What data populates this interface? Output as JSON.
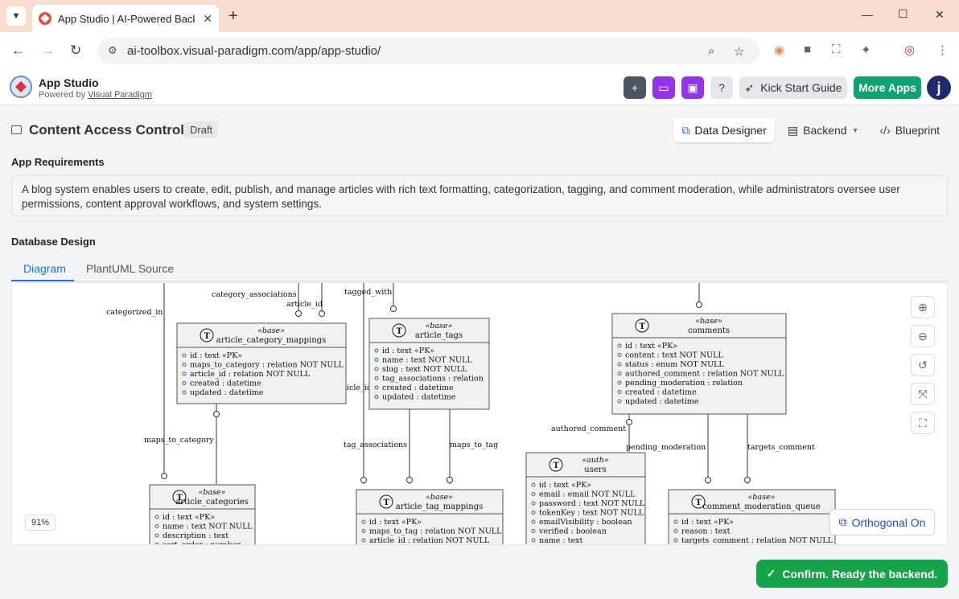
{
  "browser": {
    "tab_title": "App Studio | AI-Powered Backen",
    "url": "ai-toolbox.visual-paradigm.com/app/app-studio/"
  },
  "app": {
    "title": "App Studio",
    "powered_prefix": "Powered by",
    "powered_link": "Visual Paradigm",
    "kick_start_label": "Kick Start Guide",
    "more_apps_label": "More Apps",
    "avatar_letter": "j"
  },
  "page": {
    "title": "Content Access Control",
    "status_badge": "Draft",
    "view_tabs": [
      "Data Designer",
      "Backend",
      "Blueprint"
    ],
    "requirements_label": "App Requirements",
    "requirements_text": "A blog system enables users to create, edit, publish, and manage articles with rich text formatting, categorization, tagging, and comment moderation, while administrators oversee user permissions, content approval workflows, and system settings.",
    "db_label": "Database Design",
    "sub_tabs": [
      "Diagram",
      "PlantUML Source"
    ],
    "zoom": "91%",
    "ortho_label": "Orthogonal On",
    "confirm_label": "Confirm. Ready the backend."
  },
  "diagram": {
    "entities": [
      {
        "stereotype": "«base»",
        "name": "article_category_mappings",
        "fields": [
          "id : text «PK»",
          "maps_to_category : relation NOT NULL",
          "article_id : relation NOT NULL",
          "created : datetime",
          "updated : datetime"
        ]
      },
      {
        "stereotype": "«base»",
        "name": "article_tags",
        "fields": [
          "id : text «PK»",
          "name : text NOT NULL",
          "slug : text NOT NULL",
          "tag_associations : relation",
          "created : datetime",
          "updated : datetime"
        ]
      },
      {
        "stereotype": "«base»",
        "name": "comments",
        "fields": [
          "id : text «PK»",
          "content : text NOT NULL",
          "status : enum NOT NULL",
          "authored_comment : relation NOT NULL",
          "pending_moderation : relation",
          "created : datetime",
          "updated : datetime"
        ]
      },
      {
        "stereotype": "«base»",
        "name": "article_categories",
        "fields": [
          "id : text «PK»",
          "name : text NOT NULL",
          "description : text",
          "sort_order : number"
        ]
      },
      {
        "stereotype": "«base»",
        "name": "article_tag_mappings",
        "fields": [
          "id : text «PK»",
          "maps_to_tag : relation NOT NULL",
          "article_id : relation NOT NULL"
        ]
      },
      {
        "stereotype": "«auth»",
        "name": "users",
        "fields": [
          "id : text «PK»",
          "email : email NOT NULL",
          "password : text NOT NULL",
          "tokenKey : text NOT NULL",
          "emailVisibility : boolean",
          "verified : boolean",
          "name : text"
        ]
      },
      {
        "stereotype": "«base»",
        "name": "comment_moderation_queue",
        "fields": [
          "id : text «PK»",
          "reason : text",
          "targets_comment : relation NOT NULL"
        ]
      }
    ],
    "labels": [
      "categorized_in",
      "category_associations",
      "article_id",
      "tagged_with",
      "article_id",
      "maps_to_category",
      "tag_associations",
      "maps_to_tag",
      "authored_comment",
      "pending_moderation",
      "targets_comment"
    ]
  }
}
